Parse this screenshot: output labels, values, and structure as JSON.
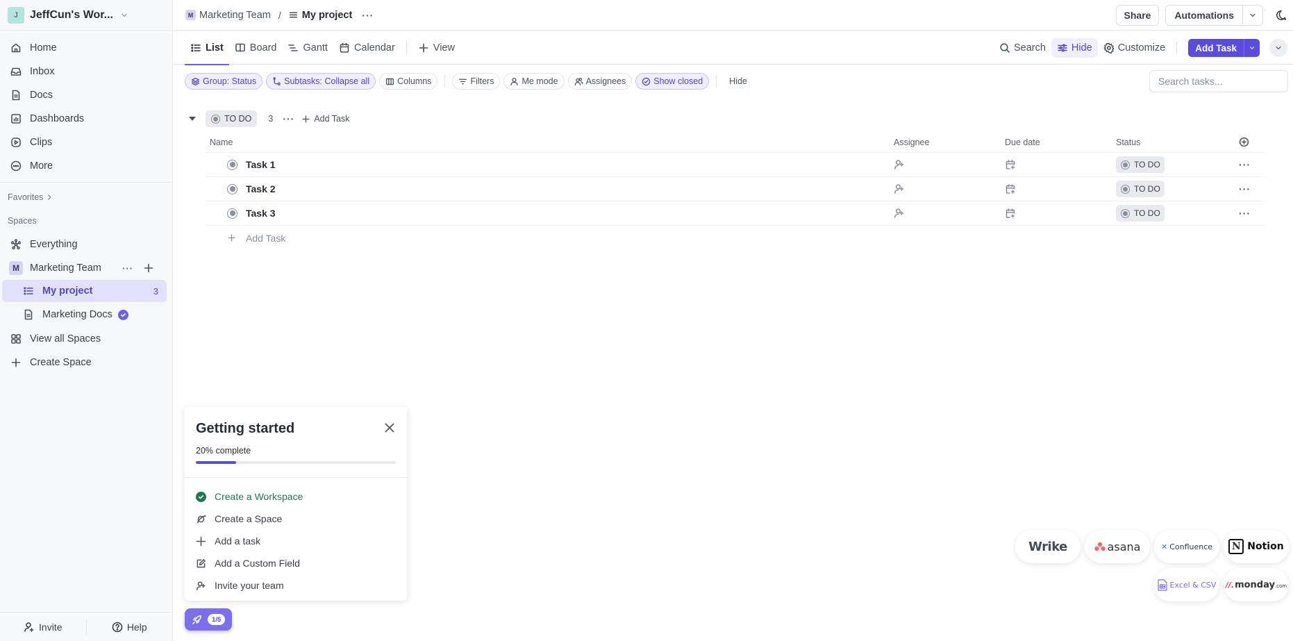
{
  "sidebar": {
    "workspace": {
      "initial": "J",
      "name": "JeffCun's Wor..."
    },
    "nav": [
      {
        "label": "Home",
        "icon": "home-icon"
      },
      {
        "label": "Inbox",
        "icon": "inbox-icon"
      },
      {
        "label": "Docs",
        "icon": "docs-icon"
      },
      {
        "label": "Dashboards",
        "icon": "dashboards-icon"
      },
      {
        "label": "Clips",
        "icon": "clips-icon"
      },
      {
        "label": "More",
        "icon": "more-icon"
      }
    ],
    "favorites_label": "Favorites",
    "spaces_label": "Spaces",
    "everything_label": "Everything",
    "space": {
      "initial": "M",
      "name": "Marketing Team"
    },
    "lists": [
      {
        "label": "My project",
        "count": "3",
        "active": true
      },
      {
        "label": "Marketing Docs"
      }
    ],
    "view_all_spaces": "View all Spaces",
    "create_space": "Create Space",
    "footer": {
      "invite": "Invite",
      "help": "Help"
    }
  },
  "topbar": {
    "breadcrumb_space_initial": "M",
    "breadcrumb_space": "Marketing Team",
    "breadcrumb_separator": "/",
    "breadcrumb_current": "My project",
    "share": "Share",
    "automations": "Automations"
  },
  "views": {
    "tabs": [
      {
        "label": "List",
        "active": true
      },
      {
        "label": "Board"
      },
      {
        "label": "Gantt"
      },
      {
        "label": "Calendar"
      }
    ],
    "add_view": "View",
    "search": "Search",
    "hide": "Hide",
    "customize": "Customize",
    "add_task": "Add Task"
  },
  "filters": {
    "group": "Group: Status",
    "subtasks": "Subtasks: Collapse all",
    "columns": "Columns",
    "filters": "Filters",
    "me_mode": "Me mode",
    "assignees": "Assignees",
    "show_closed": "Show closed",
    "hide": "Hide",
    "search_placeholder": "Search tasks..."
  },
  "group": {
    "status": "TO DO",
    "count": "3",
    "add_task": "Add Task",
    "columns": {
      "name": "Name",
      "assignee": "Assignee",
      "due_date": "Due date",
      "status": "Status"
    },
    "tasks": [
      {
        "name": "Task 1",
        "status": "TO DO"
      },
      {
        "name": "Task 2",
        "status": "TO DO"
      },
      {
        "name": "Task 3",
        "status": "TO DO"
      }
    ],
    "add_task_row": "Add Task"
  },
  "getting_started": {
    "title": "Getting started",
    "progress_label": "20% complete",
    "progress": 0.2,
    "items": [
      {
        "label": "Create a Workspace",
        "done": true
      },
      {
        "label": "Create a Space",
        "done": false
      },
      {
        "label": "Add a task",
        "done": false
      },
      {
        "label": "Add a Custom Field",
        "done": false
      },
      {
        "label": "Invite your team",
        "done": false
      }
    ],
    "launcher_badge": "1/5"
  },
  "imports": {
    "wrike": "Wrike",
    "asana": "asana",
    "confluence": "Confluence",
    "notion": "Notion",
    "excel": "Excel & CSV",
    "monday": "monday",
    "monday_suffix": ".com"
  },
  "colors": {
    "accent": "#5b4ce0",
    "done_green": "#1e7a4c"
  }
}
